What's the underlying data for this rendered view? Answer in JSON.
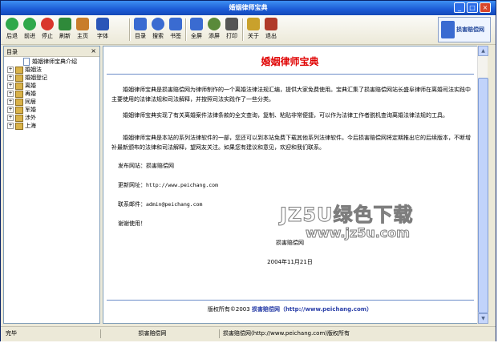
{
  "window": {
    "title": "婚姻律师宝典"
  },
  "toolbar": {
    "items": [
      {
        "label": "后退",
        "icon": "back-icon",
        "color": "#2fa84a"
      },
      {
        "label": "前进",
        "icon": "forward-icon",
        "color": "#2fa84a"
      },
      {
        "label": "停止",
        "icon": "stop-icon",
        "color": "#d9362c"
      },
      {
        "label": "刷新",
        "icon": "refresh-icon",
        "color": "#2f8a3a"
      },
      {
        "label": "主页",
        "icon": "home-icon",
        "color": "#c87d2a"
      },
      {
        "label": "字体",
        "icon": "font-icon",
        "color": "#2a56b8"
      },
      {
        "label": "目录",
        "icon": "catalog-icon",
        "color": "#3a6bd1"
      },
      {
        "label": "搜索",
        "icon": "search-icon",
        "color": "#3a6bd1"
      },
      {
        "label": "书签",
        "icon": "bookmark-icon",
        "color": "#3a6bd1"
      },
      {
        "label": "全屏",
        "icon": "fullscreen-icon",
        "color": "#3a6bd1"
      },
      {
        "label": "添屏",
        "icon": "clock-icon",
        "color": "#5a8a3a"
      },
      {
        "label": "打印",
        "icon": "print-icon",
        "color": "#555555"
      },
      {
        "label": "关于",
        "icon": "about-icon",
        "color": "#c9a12c"
      },
      {
        "label": "退出",
        "icon": "exit-icon",
        "color": "#b03a2a"
      }
    ],
    "logo_text": "损害赔偿网"
  },
  "sidebar": {
    "title": "目录",
    "items": [
      {
        "label": "婚姻律师宝典介绍",
        "type": "doc"
      },
      {
        "label": "婚姻法",
        "type": "book"
      },
      {
        "label": "婚姻登记",
        "type": "book"
      },
      {
        "label": "离婚",
        "type": "book"
      },
      {
        "label": "再婚",
        "type": "book"
      },
      {
        "label": "同居",
        "type": "book"
      },
      {
        "label": "军婚",
        "type": "book"
      },
      {
        "label": "涉外",
        "type": "book"
      },
      {
        "label": "上海",
        "type": "book"
      }
    ]
  },
  "content": {
    "title": "婚姻律师宝典",
    "p1": "婚姻律师宝典是损害赔偿网为律师制作的一个离婚法律法规汇编，提供大家免费使用。宝典汇集了损害赔偿网站长盛阜律师在离婚司法实践中主要使用的法律法规和司法解释，并按照司法实践作了一些分类。",
    "p2": "婚姻律师宝典实现了有关离婚案件法律条款的全文查询，复制、粘贴非常便捷，可以作为法律工作者脱机查询离婚法律法规的工具。",
    "p3": "婚姻律师宝典是本站的系列法律软件的一部，您还可以到本站免费下载其他系列法律软件。今后损害赔偿网将定期推出它的后续版本，不断增补最新颁布的法律和司法解释，望网友关注。如果您有建议和意见，欢迎和我们联系。",
    "publisher_label": "发布网站：损害赔偿网",
    "update_label": "更新网址：",
    "update_url": "http://www.peichang.com",
    "email_label": "联系邮件：",
    "email": "admin@peichang.com",
    "thanks": "谢谢使用！",
    "signature": "损害赔偿网",
    "date": "2004年11月21日",
    "footer_prefix": "版权所有©2003",
    "footer_brand": "损害赔偿网",
    "footer_url": "（http://www.peichang.com）"
  },
  "watermark": {
    "line1": "JZ5U绿色下载",
    "line2": "www.jz5u.com"
  },
  "statusbar": {
    "left": "完毕",
    "middle": "损害赔偿网",
    "right": "损害赔偿网(http://www.peichang.com)版权所有"
  }
}
